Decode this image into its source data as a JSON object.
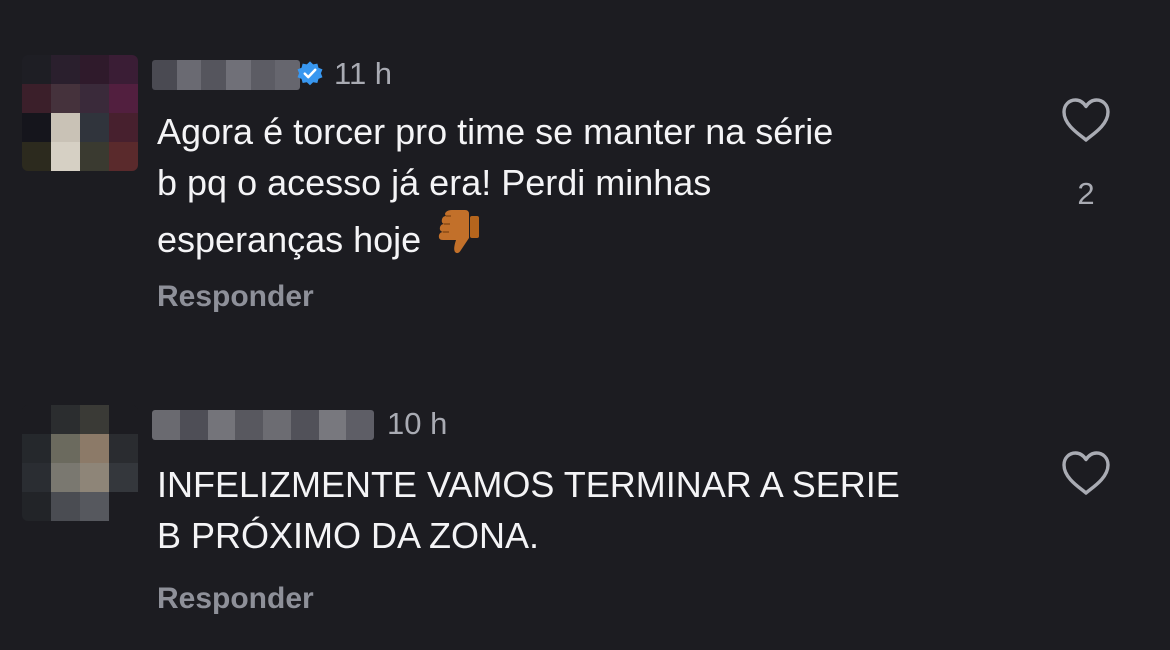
{
  "comments": [
    {
      "timestamp": "11 h",
      "verified": true,
      "text": "Agora é torcer pro time se manter na série\nb pq o acesso já era! Perdi minhas\nesperanças hoje",
      "emoji": "thumbs-down-icon",
      "like_count": "2",
      "reply_label": "Responder"
    },
    {
      "timestamp": "10 h",
      "verified": false,
      "text": "INFELIZMENTE VAMOS TERMINAR A SERIE\nB PRÓXIMO DA ZONA.",
      "reply_label": "Responder"
    }
  ],
  "colors": {
    "background": "#1c1c21",
    "text": "#f4f4f6",
    "muted": "#8e9099",
    "verified": "#3897f0"
  }
}
